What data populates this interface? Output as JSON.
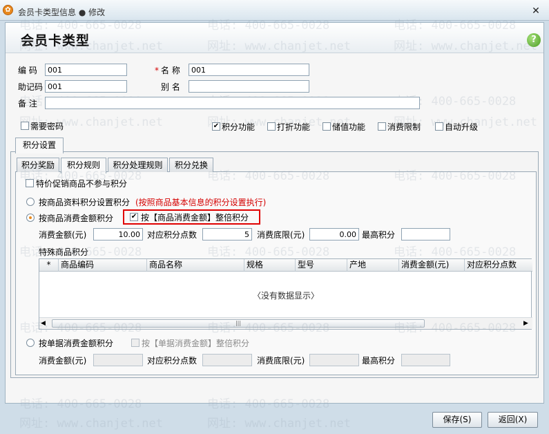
{
  "window": {
    "title": "会员卡类型信息 ● 修改",
    "close_glyph": "✕",
    "app_icon_glyph": "✿"
  },
  "header": {
    "title": "会员卡类型",
    "help_glyph": "?"
  },
  "form": {
    "code_label": "编  码",
    "code_value": "001",
    "name_required_mark": "*",
    "name_label": "名  称",
    "name_value": "001",
    "mnemonic_label": "助记码",
    "mnemonic_value": "001",
    "alias_label": "别  名",
    "alias_value": "",
    "remark_label": "备  注",
    "remark_value": ""
  },
  "options": {
    "need_password": "需要密码",
    "points": "积分功能",
    "discount": "打折功能",
    "stored_value": "储值功能",
    "consume_limit": "消费限制",
    "auto_upgrade": "自动升级"
  },
  "outer_tabs": [
    "积分设置"
  ],
  "inner_tabs": [
    "积分奖励",
    "积分规则",
    "积分处理规则",
    "积分兑换"
  ],
  "rules": {
    "promo_exclude": "特价促销商品不参与积分",
    "by_goods_info": "按商品资料积分设置积分",
    "by_goods_info_hint": "(按照商品基本信息的积分设置执行)",
    "by_goods_amount": "按商品消费金额积分",
    "goods_whole_multiple": "按【商品消费金额】整倍积分",
    "amount_label": "消费金额(元)",
    "amount_value": "10.00",
    "points_label": "对应积分点数",
    "points_value": "5",
    "min_label": "消费底限(元)",
    "min_value": "0.00",
    "max_label": "最高积分",
    "max_value": "",
    "special_goods_label": "特殊商品积分",
    "by_bill_amount": "按单据消费金额积分",
    "bill_whole_multiple": "按【单据消费金额】整倍积分",
    "bill_amount_label": "消费金额(元)",
    "bill_points_label": "对应积分点数",
    "bill_min_label": "消费底限(元)",
    "bill_max_label": "最高积分"
  },
  "grid": {
    "columns": [
      "*",
      "商品编码",
      "商品名称",
      "规格",
      "型号",
      "产地",
      "消费金额(元)",
      "对应积分点数"
    ],
    "empty_text": "〈没有数据显示〉",
    "scroll_left": "◀",
    "scroll_right": "▶",
    "thumb_grip": "|||"
  },
  "footer": {
    "save": "保存(S)",
    "back": "返回(X)"
  },
  "watermark": {
    "phone": "电话: 400-665-0028",
    "site": "网址: www.chanjet.net"
  },
  "colors": {
    "accent": "#e8891e",
    "hint_red": "#d40000",
    "highlight_box": "#e00000"
  }
}
